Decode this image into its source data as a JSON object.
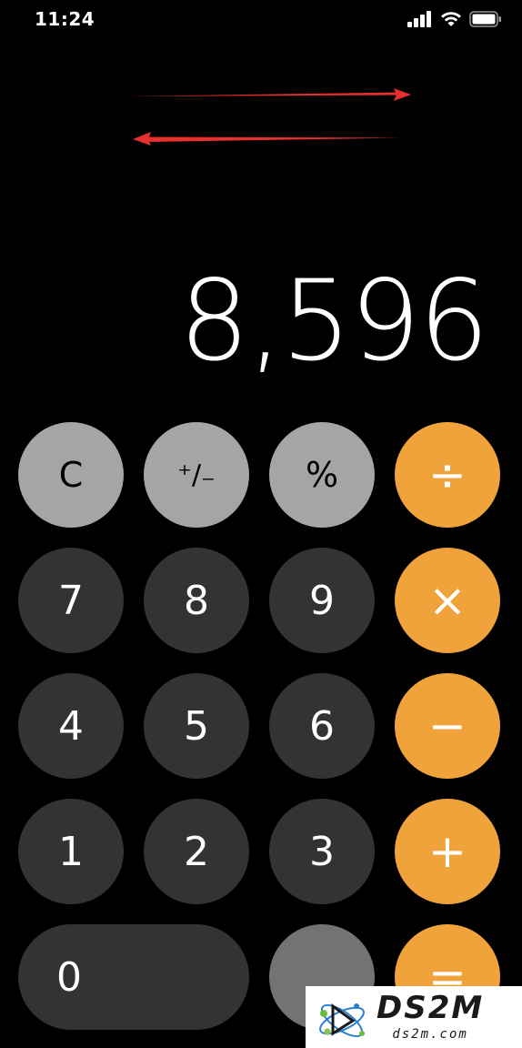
{
  "status_bar": {
    "time": "11:24"
  },
  "display": {
    "value": "8,596"
  },
  "buttons": {
    "clear": "C",
    "sign": "⁺∕₋",
    "percent": "%",
    "divide": "÷",
    "multiply": "×",
    "subtract": "−",
    "add": "+",
    "equals": "=",
    "seven": "7",
    "eight": "8",
    "nine": "9",
    "four": "4",
    "five": "5",
    "six": "6",
    "one": "1",
    "two": "2",
    "three": "3",
    "zero": "0"
  },
  "annotation": {
    "arrow_color": "#e8302e",
    "arrows": [
      "arrow-right",
      "arrow-left"
    ]
  },
  "watermark": {
    "brand": "DS2M",
    "url": "ds2m.com"
  },
  "colors": {
    "operator": "#f1a33b",
    "function": "#a5a5a5",
    "number": "#333333",
    "background": "#000000"
  }
}
